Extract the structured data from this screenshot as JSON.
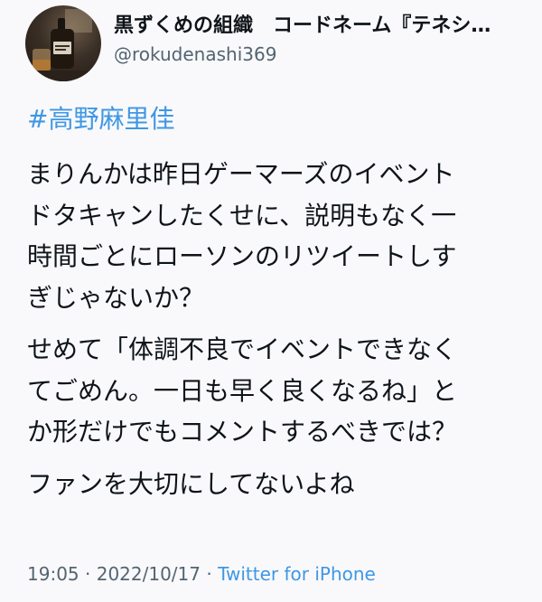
{
  "author": {
    "display_name": "黒ずくめの組織　コードネーム『テネシ…",
    "handle": "@rokudenashi369"
  },
  "tweet": {
    "hashtag": "#高野麻里佳",
    "paragraphs": [
      {
        "lines": [
          "まりんかは昨日ゲーマーズのイベント",
          "ドタキャンしたくせに、説明もなく一",
          "時間ごとにローソンのリツイートしす",
          "ぎじゃないか？"
        ]
      },
      {
        "lines": [
          "せめて「体調不良でイベントできなく",
          "てごめん。一日も早く良くなるね」と",
          "か形だけでもコメントするべきでは？"
        ]
      },
      {
        "lines": [
          "ファンを大切にしてないよね"
        ]
      }
    ]
  },
  "meta": {
    "time": "19:05",
    "separator": "·",
    "date": "2022/10/17",
    "source": "Twitter for iPhone"
  },
  "colors": {
    "link": "#3f97e4",
    "secondary_text": "#536471",
    "primary_text": "#0f1419",
    "background": "#f9f9fb"
  },
  "icons": {
    "avatar": "whiskey-bottle-photo"
  }
}
